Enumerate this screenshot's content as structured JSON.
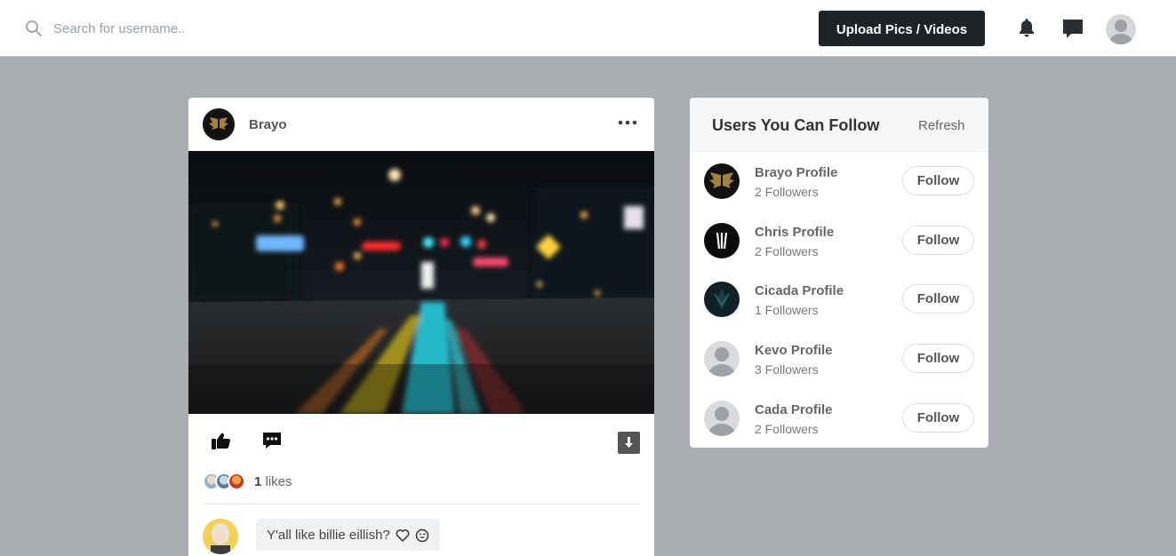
{
  "header": {
    "search_placeholder": "Search for username..",
    "upload_label": "Upload Pics / Videos"
  },
  "post": {
    "username": "Brayo",
    "likes_count": "1",
    "likes_label": " likes",
    "comment_text": "Y'all like billie eillish?"
  },
  "follow_panel": {
    "title": "Users You Can Follow",
    "refresh_label": "Refresh",
    "users": [
      {
        "name": "Brayo Profile",
        "followers": "2 Followers",
        "button": "Follow"
      },
      {
        "name": "Chris Profile",
        "followers": "2 Followers",
        "button": "Follow"
      },
      {
        "name": "Cicada Profile",
        "followers": "1 Followers",
        "button": "Follow"
      },
      {
        "name": "Kevo Profile",
        "followers": "3 Followers",
        "button": "Follow"
      },
      {
        "name": "Cada Profile",
        "followers": "2 Followers",
        "button": "Follow"
      }
    ]
  },
  "icons": {
    "search": "search-icon",
    "notifications": "bell-icon",
    "messages": "chat-icon",
    "like": "thumbs-up-icon",
    "comment": "comment-icon",
    "download": "download-icon",
    "more": "more-horizontal-icon",
    "heart": "heart-icon",
    "emoji": "wink-emoji-icon"
  },
  "colors": {
    "page_bg": "#aaadb1",
    "upload_button_bg": "#1f2326",
    "card_bg": "#ffffff"
  }
}
